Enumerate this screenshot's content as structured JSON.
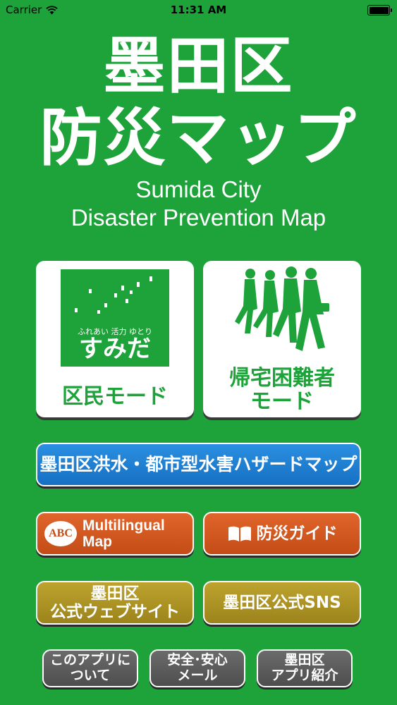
{
  "status_bar": {
    "carrier": "Carrier",
    "time": "11:31 AM"
  },
  "title": {
    "jp_line1": "墨田区",
    "jp_line2": "防災マップ",
    "en_line1": "Sumida City",
    "en_line2": "Disaster Prevention Map"
  },
  "cards": {
    "resident": {
      "tagline": "ふれあい 活力 ゆとり",
      "logo_text": "すみだ",
      "label": "区民モード"
    },
    "commuter": {
      "label_line1": "帰宅困難者",
      "label_line2": "モード"
    }
  },
  "buttons": {
    "hazard_map": "墨田区洪水・都市型水害ハザードマップ",
    "multilingual_badge": "ABC",
    "multilingual_line1": "Multilingual",
    "multilingual_line2": "Map",
    "guide": "防災ガイド",
    "website_line1": "墨田区",
    "website_line2": "公式ウェブサイト",
    "sns": "墨田区公式SNS",
    "about_line1": "このアプリに",
    "about_line2": "ついて",
    "safety_line1": "安全･安心",
    "safety_line2": "メール",
    "apps_line1": "墨田区",
    "apps_line2": "アプリ紹介"
  },
  "colors": {
    "background": "#1ea23a",
    "blue": "#1f7fd6",
    "orange": "#d6571f",
    "olive": "#ae9424",
    "gray": "#5c5c5c"
  }
}
